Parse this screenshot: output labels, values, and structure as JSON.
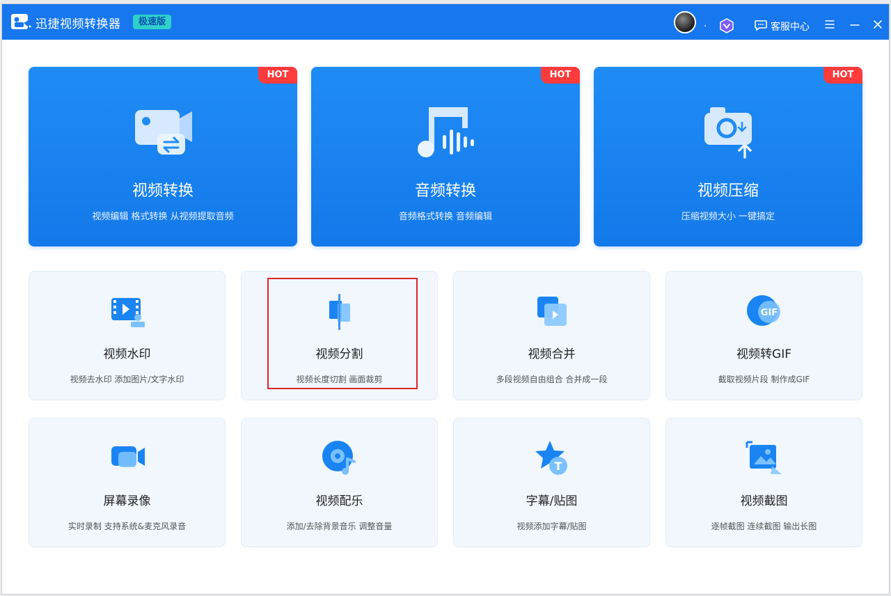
{
  "header": {
    "app_title": "迅捷视频转换器",
    "edition": "极速版",
    "avatar_suffix": ".",
    "service_label": "客服中心"
  },
  "featured": [
    {
      "title": "视频转换",
      "desc": "视频编辑 格式转换 从视频提取音频",
      "badge": "HOT"
    },
    {
      "title": "音频转换",
      "desc": "音频格式转换 音频编辑",
      "badge": "HOT"
    },
    {
      "title": "视频压缩",
      "desc": "压缩视频大小 一键搞定",
      "badge": "HOT"
    }
  ],
  "tools": [
    {
      "title": "视频水印",
      "desc": "视频去水印 添加图片/文字水印"
    },
    {
      "title": "视频分割",
      "desc": "视频长度切割 画面裁剪"
    },
    {
      "title": "视频合并",
      "desc": "多段视频自由组合 合并成一段"
    },
    {
      "title": "视频转GIF",
      "desc": "截取视频片段 制作成GIF"
    },
    {
      "title": "屏幕录像",
      "desc": "实时录制 支持系统&麦克风录音"
    },
    {
      "title": "视频配乐",
      "desc": "添加/去除背景音乐 调整音量"
    },
    {
      "title": "字幕/贴图",
      "desc": "视频添加字幕/贴图"
    },
    {
      "title": "视频截图",
      "desc": "逐帧截图 连续截图 输出长图"
    }
  ],
  "icons": {
    "gif_label": "GIF",
    "subtitle_label": "T"
  },
  "colors": {
    "titlebar": "#1677ee",
    "hot_badge": "#ff3b3b",
    "highlight": "#d9262b"
  }
}
